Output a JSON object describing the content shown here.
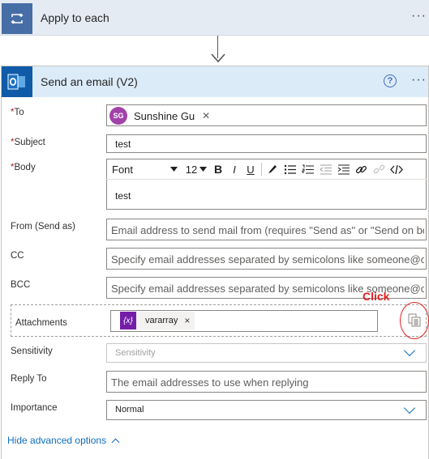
{
  "loop": {
    "title": "Apply to each",
    "menu": "···",
    "icon": "loop-icon"
  },
  "action": {
    "title": "Send an email (V2)",
    "menu": "···",
    "icon": "outlook-icon",
    "help": "?"
  },
  "fields": {
    "to": {
      "label": "To",
      "required_mark": "*",
      "recipient_initials": "SG",
      "recipient_name": "Sunshine Gu",
      "remove": "✕"
    },
    "subject": {
      "label": "Subject",
      "required_mark": "*",
      "value": "test"
    },
    "body": {
      "label": "Body",
      "required_mark": "*",
      "font": "Font",
      "font_size": "12",
      "content": "test"
    },
    "from": {
      "label": "From (Send as)",
      "placeholder": "Email address to send mail from (requires \"Send as\" or \"Send on be..."
    },
    "cc": {
      "label": "CC",
      "placeholder": "Specify email addresses separated by semicolons like someone@c..."
    },
    "bcc": {
      "label": "BCC",
      "placeholder": "Specify email addresses separated by semicolons like someone@c..."
    },
    "attachments": {
      "label": "Attachments",
      "token_icon": "{x}",
      "token_name": "vararray",
      "token_remove": "×"
    },
    "sensitivity": {
      "label": "Sensitivity",
      "placeholder": "Sensitivity"
    },
    "reply_to": {
      "label": "Reply To",
      "placeholder": "The email addresses to use when replying"
    },
    "importance": {
      "label": "Importance",
      "value": "Normal"
    }
  },
  "annotation": {
    "text": "Click"
  },
  "footer": {
    "hide_advanced": "Hide advanced options"
  },
  "colors": {
    "loop_accent": "#476da6",
    "outlook_accent": "#0f5ba7",
    "header_bg": "#dcebf8",
    "link": "#0f6cbd",
    "annotation": "#e02020",
    "avatar": "#a142a8",
    "variable": "#741ea7"
  }
}
